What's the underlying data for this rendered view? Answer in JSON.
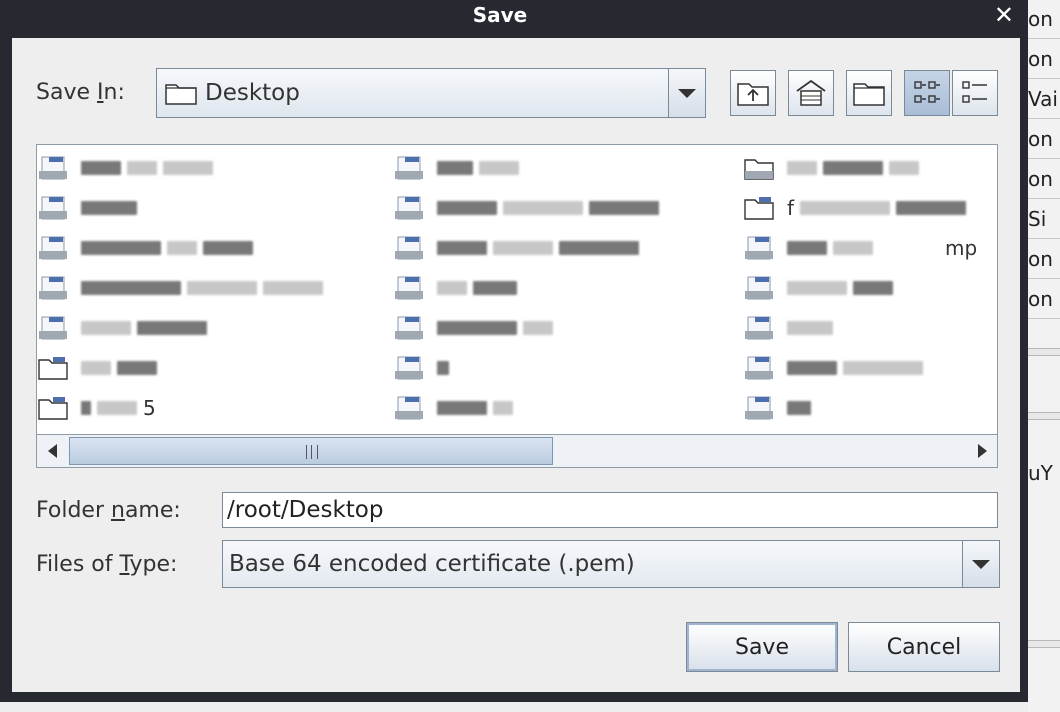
{
  "dialog": {
    "title": "Save",
    "close_glyph": "✕"
  },
  "save_in": {
    "label_pre": "Save ",
    "label_mn": "I",
    "label_post": "n:",
    "value": "Desktop",
    "icon": "folder-icon"
  },
  "toolbar": {
    "buttons": [
      {
        "name": "up-one-level-button",
        "icon": "folder-up-icon"
      },
      {
        "name": "home-button",
        "icon": "home-icon"
      },
      {
        "name": "new-folder-button",
        "icon": "new-folder-icon"
      },
      {
        "name": "list-view-button",
        "icon": "list-view-icon",
        "active": true
      },
      {
        "name": "details-view-button",
        "icon": "details-view-icon",
        "active": false
      }
    ]
  },
  "file_list": {
    "visible_fragments": {
      "col3_row2": "f",
      "col3_row3": "mp",
      "col1_row7": "5"
    }
  },
  "folder_name": {
    "label_pre": "Folder ",
    "label_mn": "n",
    "label_post": "ame:",
    "value": "/root/Desktop"
  },
  "files_of_type": {
    "label_pre": "Files of ",
    "label_mn": "T",
    "label_post": "ype:",
    "value": "Base 64 encoded certificate (.pem)"
  },
  "actions": {
    "save_label": "Save",
    "cancel_label": "Cancel"
  },
  "background": {
    "rows": [
      "on",
      "on",
      "Vai",
      "on",
      "on",
      "Si",
      "on",
      "on"
    ],
    "fragment": "uY"
  }
}
